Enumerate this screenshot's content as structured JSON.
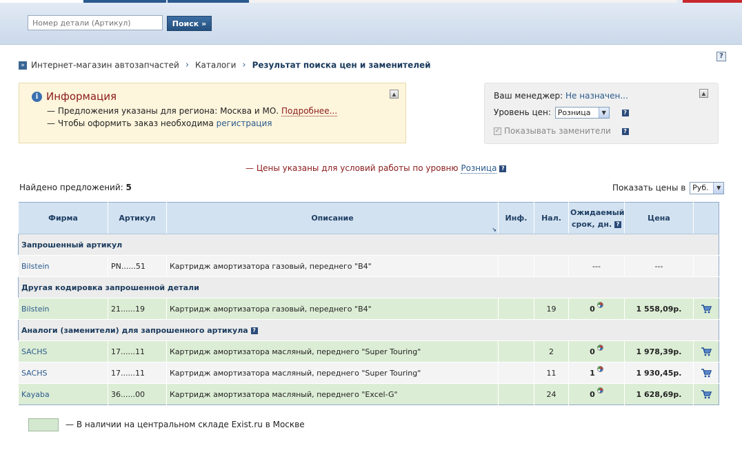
{
  "search": {
    "placeholder": "Номер детали (Артикул)",
    "button_label": "Поиск »"
  },
  "help_icon": "?",
  "breadcrumb": {
    "items": [
      "Интернет-магазин автозапчастей",
      "Каталоги"
    ],
    "current": "Результат поиска цен и заменителей",
    "separator": "›"
  },
  "info": {
    "title": "Информация",
    "line1_prefix": "— Предложения указаны для региона: Москва и МО.",
    "line1_link": "Подробнее...",
    "line2_prefix": "— Чтобы оформить заказ необходима",
    "line2_link": "регистрация"
  },
  "manager": {
    "label": "Ваш менеджер:",
    "value": "Не назначен...",
    "price_level_label": "Уровень цен:",
    "price_level_value": "Розница",
    "show_replacements_label": "Показывать заменители",
    "show_replacements_checked": true
  },
  "price_note": {
    "prefix": "— Цены указаны для условий работы по уровню",
    "level": "Розница"
  },
  "found": {
    "label": "Найдено предложений:",
    "count": "5"
  },
  "currency": {
    "label": "Показать цены в",
    "value": "Руб."
  },
  "table": {
    "headers": {
      "brand": "Фирма",
      "article": "Артикул",
      "description": "Описание",
      "info": "Инф.",
      "stock": "Нал.",
      "eta_line1": "Ожидаемый",
      "eta_line2": "срок, дн.",
      "price": "Цена"
    },
    "groups": {
      "requested": "Запрошенный артикул",
      "other_code": "Другая кодировка запрошенной детали",
      "analogs": "Аналоги (заменители) для запрошенного артикула"
    },
    "rows": [
      {
        "brand": "Bilstein",
        "article": "PN......51",
        "description": "Картридж амортизатора газовый, переднего \"B4\"",
        "stock": "",
        "eta": "---",
        "price": "---"
      },
      {
        "brand": "Bilstein",
        "article": "21......19",
        "description": "Картридж амортизатора газовый, переднего \"B4\"",
        "stock": "19",
        "eta": "0",
        "price": "1 558,09р."
      },
      {
        "brand": "SACHS",
        "article": "17......11",
        "description": "Картридж амортизатора масляный, переднего \"Super Touring\"",
        "stock": "2",
        "eta": "0",
        "price": "1 978,39р."
      },
      {
        "brand": "SACHS",
        "article": "17......11",
        "description": "Картридж амортизатора масляный, переднего \"Super Touring\"",
        "stock": "11",
        "eta": "1",
        "price": "1 930,45р."
      },
      {
        "brand": "Kayaba",
        "article": "36......00",
        "description": "Картридж амортизатора масляный, переднего \"Excel-G\"",
        "stock": "24",
        "eta": "0",
        "price": "1 628,69р."
      }
    ]
  },
  "legend": {
    "text": "— В наличии на центральном складе Exist.ru в Москве"
  },
  "colors": {
    "in_stock_row": "#dcedd5",
    "header_bg": "#d3e2f1",
    "accent_blue": "#2a5a8c",
    "info_red": "#8b1a1a"
  }
}
